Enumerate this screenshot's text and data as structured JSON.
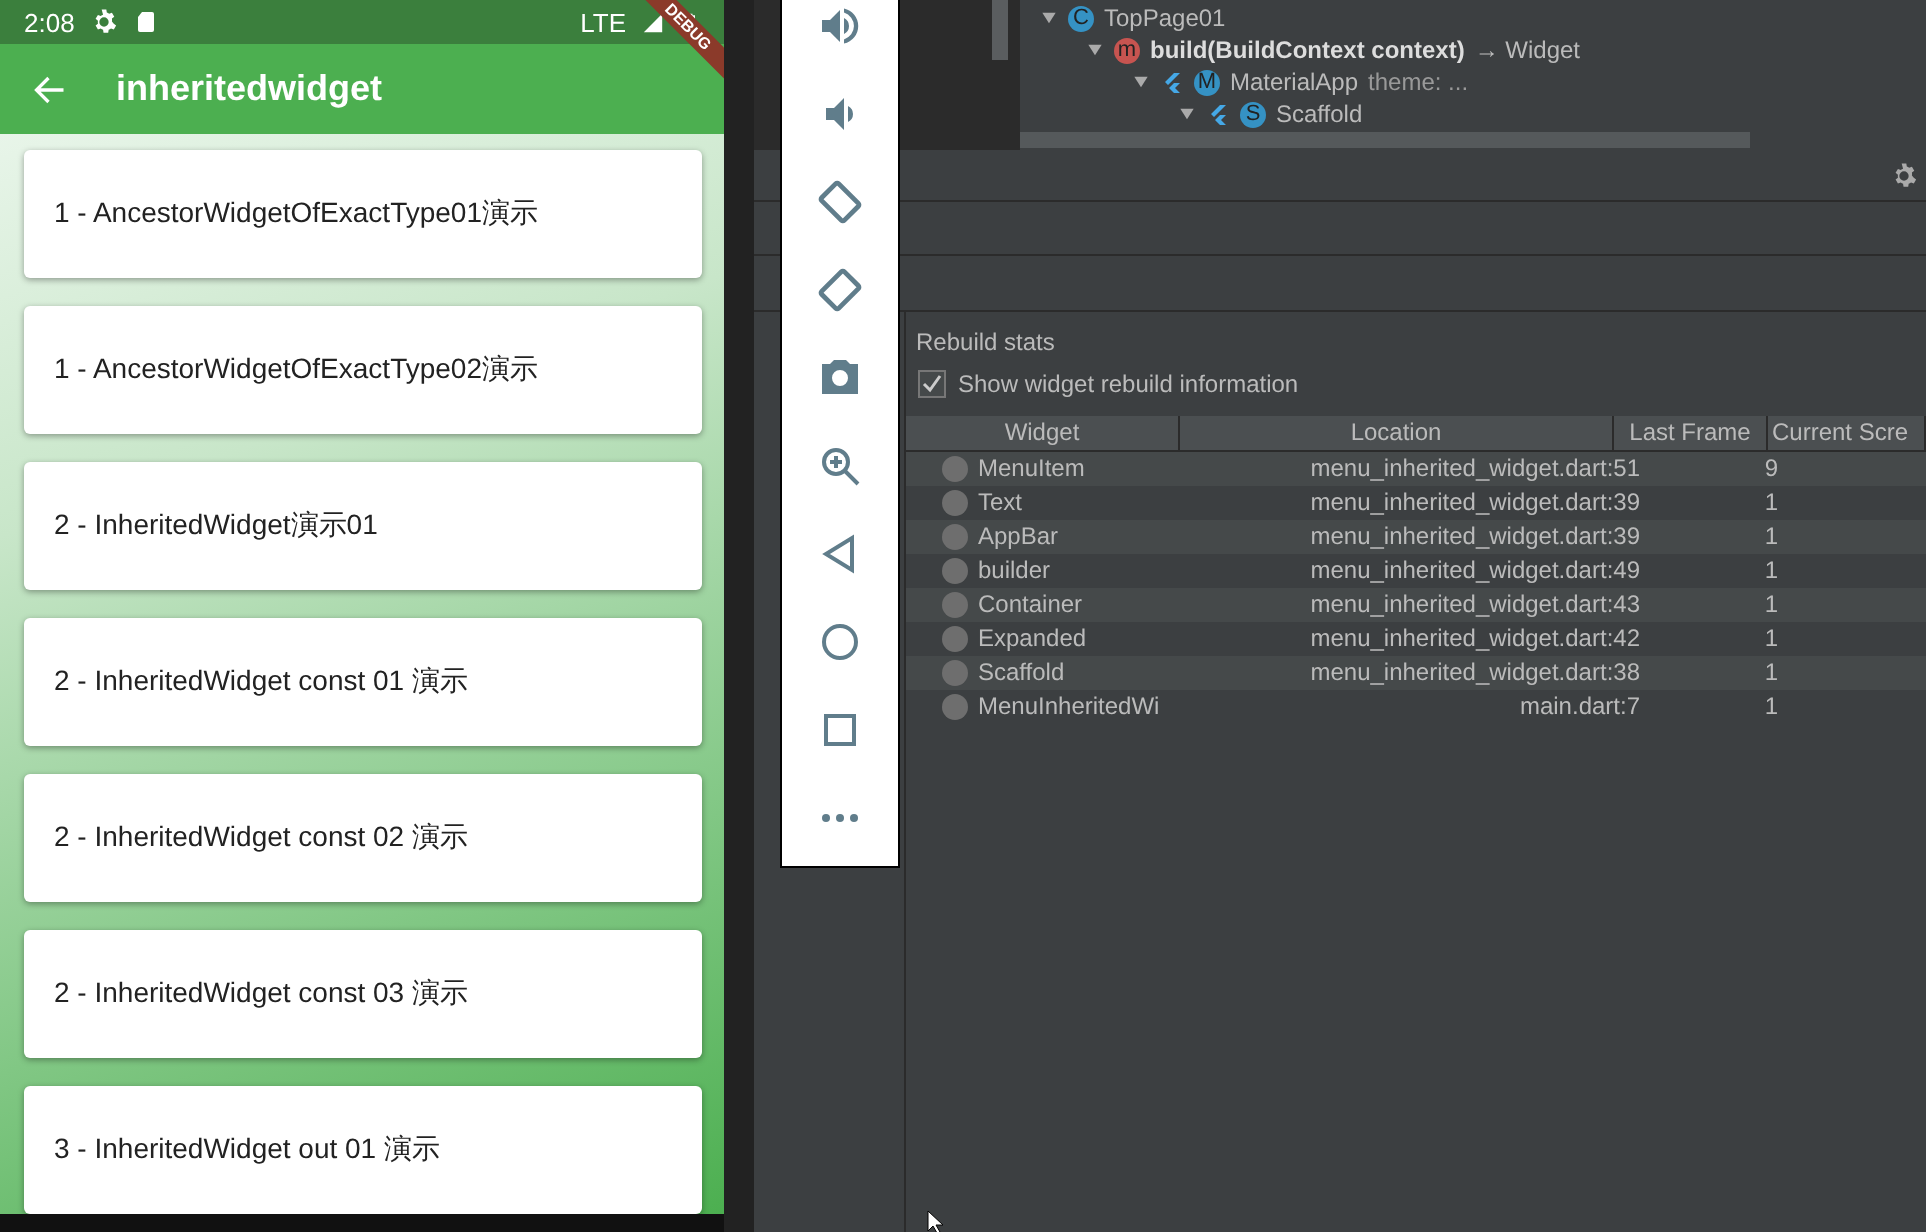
{
  "phone": {
    "status_bar": {
      "time": "2:08",
      "network": "LTE",
      "debug_banner": "DEBUG"
    },
    "app_bar": {
      "title": "inheritedwidget"
    },
    "menu_items": [
      {
        "label": "1 - AncestorWidgetOfExactType01演示"
      },
      {
        "label": "1 - AncestorWidgetOfExactType02演示"
      },
      {
        "label": "2 - InheritedWidget演示01"
      },
      {
        "label": "2 - InheritedWidget const 01 演示"
      },
      {
        "label": "2 - InheritedWidget const 02 演示"
      },
      {
        "label": "2 - InheritedWidget const 03 演示"
      },
      {
        "label": "3 - InheritedWidget out 01 演示"
      }
    ]
  },
  "widget_tree": {
    "nodes": [
      {
        "badge": "C",
        "label": "TopPage01",
        "expanded": true,
        "children": [
          {
            "badge": "m",
            "label": "build(BuildContext context)",
            "suffix": "→ Widget",
            "expanded": true,
            "children": [
              {
                "badge": "M",
                "flutter": true,
                "label": "MaterialApp",
                "detail": "theme: ...",
                "expanded": true,
                "children": [
                  {
                    "badge": "S",
                    "flutter": true,
                    "label": "Scaffold",
                    "expanded": true
                  }
                ]
              }
            ]
          }
        ]
      }
    ]
  },
  "rebuild_stats": {
    "title": "Rebuild stats",
    "show_info": {
      "label": "Show widget rebuild information",
      "checked": true
    },
    "columns": [
      "Widget",
      "Location",
      "Last Frame",
      "Current Scre"
    ],
    "rows": [
      {
        "widget": "MenuItem",
        "location": "menu_inherited_widget.dart:51",
        "last_frame": "9"
      },
      {
        "widget": "Text",
        "location": "menu_inherited_widget.dart:39",
        "last_frame": "1"
      },
      {
        "widget": "AppBar",
        "location": "menu_inherited_widget.dart:39",
        "last_frame": "1"
      },
      {
        "widget": "builder",
        "location": "menu_inherited_widget.dart:49",
        "last_frame": "1"
      },
      {
        "widget": "Container",
        "location": "menu_inherited_widget.dart:43",
        "last_frame": "1"
      },
      {
        "widget": "Expanded",
        "location": "menu_inherited_widget.dart:42",
        "last_frame": "1"
      },
      {
        "widget": "Scaffold",
        "location": "menu_inherited_widget.dart:38",
        "last_frame": "1"
      },
      {
        "widget": "MenuInheritedWi",
        "location": "main.dart:7",
        "last_frame": "1"
      }
    ]
  }
}
